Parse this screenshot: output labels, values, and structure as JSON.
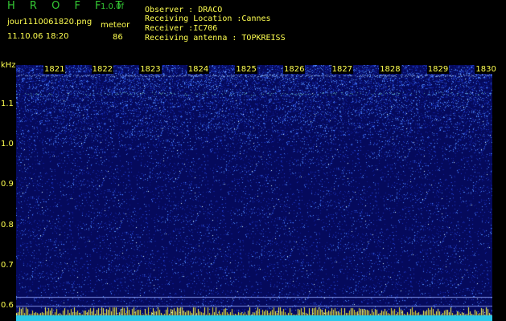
{
  "header": {
    "app_title": "H R O F F T",
    "version": "1.0.0f",
    "filename": "jour1110061820.png",
    "timestamp": "11.10.06 18:20",
    "meteor_label": "meteor",
    "meteor_count": "86",
    "observer_line": "Observer           :  DRACO",
    "location_line": "Receiving Location :Cannes",
    "receiver_line": "Receiver           :IC706",
    "antenna_line": "Receiving antenna  : TOPKREISS"
  },
  "axis": {
    "unit": "kHz",
    "y_labels": [
      "1.1",
      "1.0",
      "0.9",
      "0.8",
      "0.7",
      "0.6"
    ],
    "minute_labels": [
      "1821",
      "1822",
      "1823",
      "1824",
      "1825",
      "1826",
      "1827",
      "1828",
      "1829",
      "1830"
    ]
  },
  "colors": {
    "background": "#050a5c",
    "label": "#ffff50",
    "title": "#34c834",
    "baseline": "#29c8e8"
  }
}
